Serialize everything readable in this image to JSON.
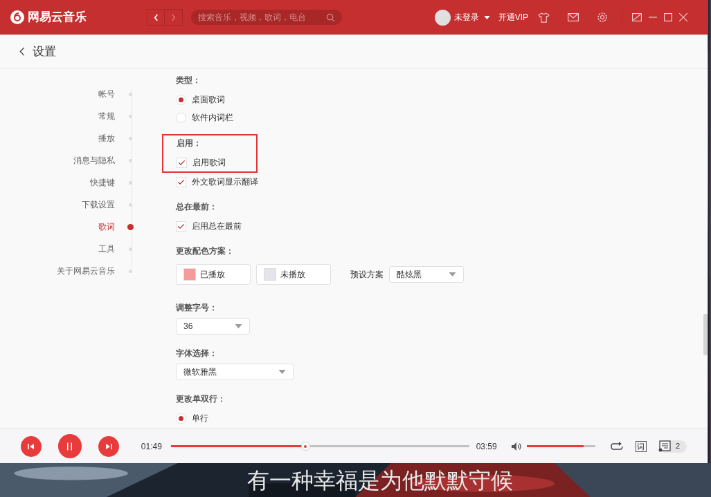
{
  "app": {
    "name": "网易云音乐"
  },
  "search": {
    "placeholder": "搜索音乐，视频，歌词，电台"
  },
  "user": {
    "name": "未登录",
    "vip": "开通VIP"
  },
  "page": {
    "title": "设置"
  },
  "sidebar": {
    "items": [
      {
        "label": "帐号",
        "selected": false
      },
      {
        "label": "常规",
        "selected": false
      },
      {
        "label": "播放",
        "selected": false
      },
      {
        "label": "消息与隐私",
        "selected": false
      },
      {
        "label": "快捷键",
        "selected": false
      },
      {
        "label": "下载设置",
        "selected": false
      },
      {
        "label": "歌词",
        "selected": true
      },
      {
        "label": "工具",
        "selected": false
      },
      {
        "label": "关于网易云音乐",
        "selected": false
      }
    ]
  },
  "sections": [
    {
      "kind": "radio",
      "title": "类型：",
      "highlighted": false,
      "options": [
        {
          "label": "桌面歌词",
          "selected": true
        },
        {
          "label": "软件内词栏",
          "selected": false
        }
      ]
    },
    {
      "kind": "checkbox",
      "title": "启用：",
      "highlighted": true,
      "options": [
        {
          "label": "启用歌词",
          "checked": true
        },
        {
          "label": "外文歌词显示翻译",
          "checked": true
        }
      ]
    },
    {
      "kind": "checkbox",
      "title": "总在最前：",
      "highlighted": false,
      "options": [
        {
          "label": "启用总在最前",
          "checked": true
        }
      ]
    },
    {
      "kind": "colors",
      "title": "更改配色方案：",
      "highlighted": false,
      "swatches": [
        {
          "label": "已播放",
          "color": "#f79a9a"
        },
        {
          "label": "未播放",
          "color": "#e4e4ea"
        }
      ],
      "preset_label": "预设方案",
      "preset": "酷炫黑"
    },
    {
      "kind": "select",
      "title": "调整字号：",
      "highlighted": false,
      "value": "36",
      "wide": false
    },
    {
      "kind": "select",
      "title": "字体选择：",
      "highlighted": false,
      "value": "微软雅黑",
      "wide": true
    },
    {
      "kind": "radio",
      "title": "更改单双行：",
      "highlighted": false,
      "options": [
        {
          "label": "单行",
          "selected": true
        }
      ]
    }
  ],
  "player": {
    "elapsed": "01:49",
    "level": 0.45,
    "duration": "03:59",
    "volume": {
      "level": 0.83
    },
    "lyrics_button": "词",
    "playlist_count": "2"
  },
  "desktop_lyrics": {
    "text": "有一种幸福是为他默默守候"
  }
}
